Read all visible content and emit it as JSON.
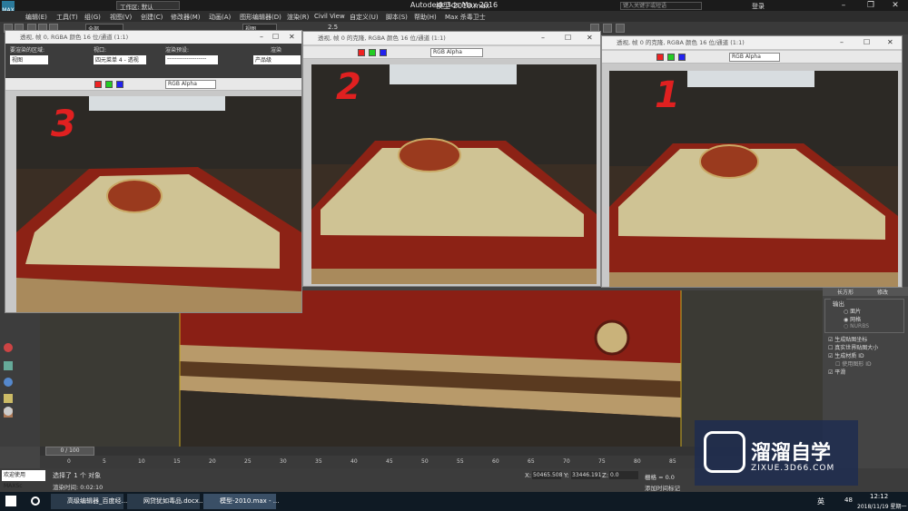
{
  "app": {
    "title": "Autodesk 3ds Max 2016",
    "file": "模型-2010.max",
    "workspace": "工作区: 默认",
    "search_placeholder": "键入关键字或短语",
    "login": "登录"
  },
  "menu": [
    "编辑(E)",
    "工具(T)",
    "组(G)",
    "视图(V)",
    "创建(C)",
    "修改器(M)",
    "动画(A)",
    "图形编辑器(D)",
    "渲染(R)",
    "Civil View",
    "自定义(U)",
    "脚本(S)",
    "帮助(H)",
    "Max 杀毒卫士"
  ],
  "toolbar": {
    "filter": "全部",
    "view": "视图",
    "snap": "2.5"
  },
  "render_windows": [
    {
      "id": "3",
      "title": "透视, 帧 0, RGBA 颜色 16 位/通道 (1:1)",
      "labels": {
        "area": "要渲染的区域:",
        "viewport": "视口:",
        "preset": "渲染预设:",
        "render": "渲染"
      },
      "values": {
        "area": "视图",
        "viewport": "四元菜单 4 - 透视",
        "preset": "--------------------",
        "product": "产品级"
      },
      "channel": "RGB Alpha",
      "handwritten": "3"
    },
    {
      "id": "2",
      "title": "透视, 帧 0 的克隆, RGBA 颜色 16 位/通道 (1:1)",
      "channel": "RGB Alpha",
      "handwritten": "2"
    },
    {
      "id": "1",
      "title": "透视, 帧 0 的克隆, RGBA 颜色 16 位/通道 (1:1)",
      "channel": "RGB Alpha",
      "handwritten": "1"
    }
  ],
  "right_panel": {
    "tabs": [
      "长方形",
      "修改"
    ],
    "output_label": "输出",
    "options": [
      "面片",
      "网格",
      "NURBS"
    ],
    "checks": [
      {
        "label": "生成贴图坐标",
        "checked": true
      },
      {
        "label": "真实世界贴图大小",
        "checked": false
      },
      {
        "label": "生成材质 ID",
        "checked": true
      },
      {
        "label": "使用图形 ID",
        "checked": false
      },
      {
        "label": "平滑",
        "checked": true
      }
    ]
  },
  "timeline": {
    "frame": "0 / 100",
    "ticks": [
      "0",
      "5",
      "10",
      "15",
      "20",
      "25",
      "30",
      "35",
      "40",
      "45",
      "50",
      "55",
      "60",
      "65",
      "70",
      "75",
      "80",
      "85"
    ]
  },
  "status": {
    "selected": "选择了 1 个 对象",
    "render_time": "渲染时间: 0:02:10",
    "x_label": "X:",
    "x": "50465.508",
    "y_label": "Y:",
    "y": "33446.191",
    "z_label": "Z:",
    "z": "0.0",
    "grid": "栅格 = 0.0",
    "add_key": "添加时间标记",
    "maxscript": "欢迎使用 MAXSc"
  },
  "taskbar": {
    "items": [
      "高级编辑器_百度经...",
      "网贷犹如毒品.docx...",
      "模型-2010.max - ..."
    ],
    "time": "12:12",
    "date": "2018/11/19 星期一",
    "ime": "英",
    "notifications": "48"
  },
  "watermark": {
    "text": "溜溜自学",
    "url": "ZIXUE.3D66.COM"
  }
}
